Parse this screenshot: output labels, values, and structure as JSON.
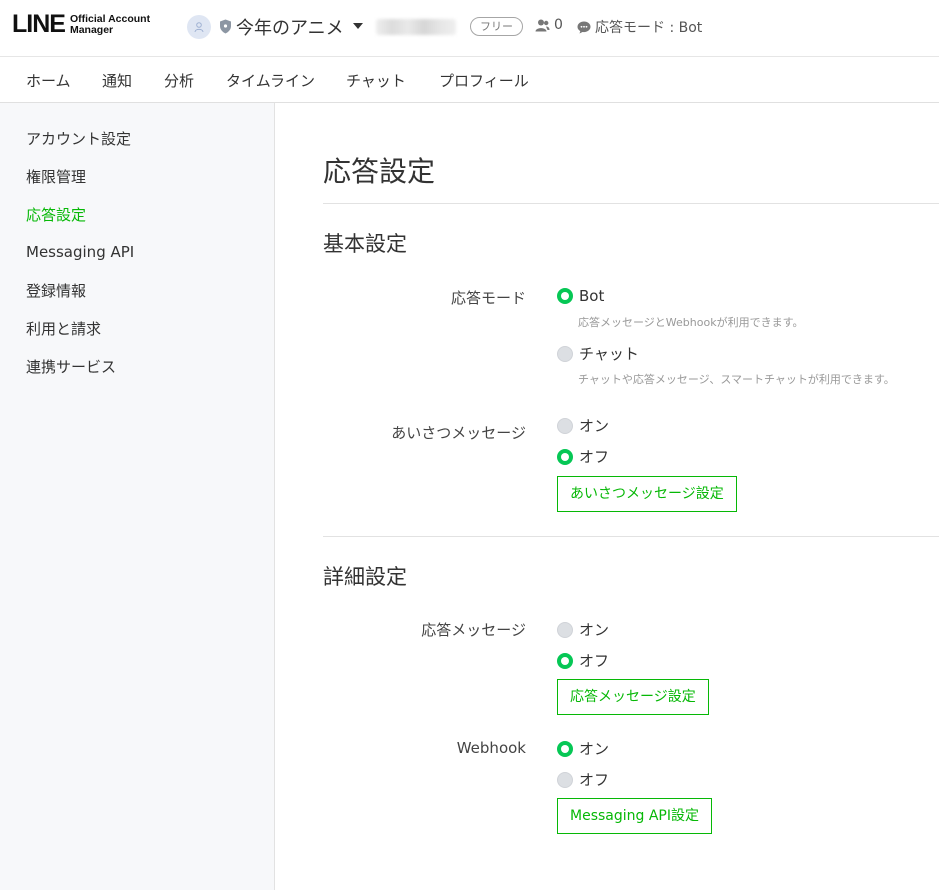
{
  "header": {
    "logo_main": "LINE",
    "logo_sub_1": "Official Account",
    "logo_sub_2": "Manager",
    "account_name": "今年のアニメ",
    "plan_badge": "フリー",
    "friend_count": "0",
    "mode_status": "応答モード : Bot"
  },
  "nav": {
    "items": [
      "ホーム",
      "通知",
      "分析",
      "タイムライン",
      "チャット",
      "プロフィール"
    ]
  },
  "sidebar": {
    "items": [
      "アカウント設定",
      "権限管理",
      "応答設定",
      "Messaging API",
      "登録情報",
      "利用と請求",
      "連携サービス"
    ],
    "active_index": 2
  },
  "main": {
    "title": "応答設定",
    "basic": {
      "title": "基本設定",
      "response_mode": {
        "label": "応答モード",
        "option_bot": "Bot",
        "option_bot_hint": "応答メッセージとWebhookが利用できます。",
        "option_chat": "チャット",
        "option_chat_hint": "チャットや応答メッセージ、スマートチャットが利用できます。",
        "selected": "Bot"
      },
      "greeting": {
        "label": "あいさつメッセージ",
        "option_on": "オン",
        "option_off": "オフ",
        "selected": "オフ",
        "button": "あいさつメッセージ設定"
      }
    },
    "advanced": {
      "title": "詳細設定",
      "auto_reply": {
        "label": "応答メッセージ",
        "option_on": "オン",
        "option_off": "オフ",
        "selected": "オフ",
        "button": "応答メッセージ設定"
      },
      "webhook": {
        "label": "Webhook",
        "option_on": "オン",
        "option_off": "オフ",
        "selected": "オン",
        "button": "Messaging API設定"
      }
    }
  },
  "colors": {
    "accent": "#06c755",
    "accent_text": "#06b806",
    "sidebar_bg": "#f7f8fa"
  },
  "icons": [
    "user-avatar-icon",
    "shield-icon",
    "caret-down-icon",
    "friends-icon",
    "chat-bubble-icon"
  ]
}
